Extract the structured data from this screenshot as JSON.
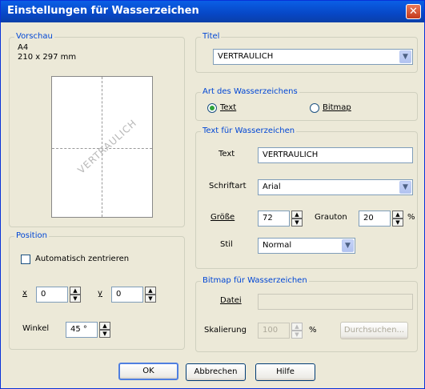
{
  "dialog": {
    "title": "Einstellungen für Wasserzeichen"
  },
  "preview": {
    "legend": "Vorschau",
    "paper_size": "A4",
    "dimensions": "210 x 297 mm",
    "watermark": "VERTRAULICH"
  },
  "titel": {
    "legend": "Titel",
    "selected": "VERTRAULICH"
  },
  "art": {
    "legend": "Art des Wasserzeichens",
    "text_label": "Text",
    "bitmap_label": "Bitmap",
    "selected": "Text"
  },
  "text_group": {
    "legend": "Text für Wasserzeichen",
    "text_label": "Text",
    "text_value": "VERTRAULICH",
    "font_label": "Schriftart",
    "font_value": "Arial",
    "size_label": "Größe",
    "size_value": "72",
    "gray_label": "Grauton",
    "gray_value": "20",
    "gray_unit": "%",
    "style_label": "Stil",
    "style_value": "Normal"
  },
  "position": {
    "legend": "Position",
    "auto_center_label": "Automatisch zentrieren",
    "auto_center_checked": false,
    "x_label": "x",
    "x_value": "0",
    "y_label": "y",
    "y_value": "0",
    "angle_label": "Winkel",
    "angle_value": "45 °"
  },
  "bitmap_group": {
    "legend": "Bitmap für Wasserzeichen",
    "file_label": "Datei",
    "file_value": "",
    "scale_label": "Skalierung",
    "scale_value": "100",
    "scale_unit": "%",
    "browse_label": "Durchsuchen..."
  },
  "buttons": {
    "ok": "OK",
    "cancel": "Abbrechen",
    "help": "Hilfe"
  },
  "icons": {
    "close": "✕",
    "dropdown": "▼",
    "spin_up": "▲",
    "spin_down": "▼"
  },
  "colors": {
    "titlebar": "#0a5fe6",
    "legend_text": "#0046d5",
    "dialog_bg": "#ece9d8"
  }
}
